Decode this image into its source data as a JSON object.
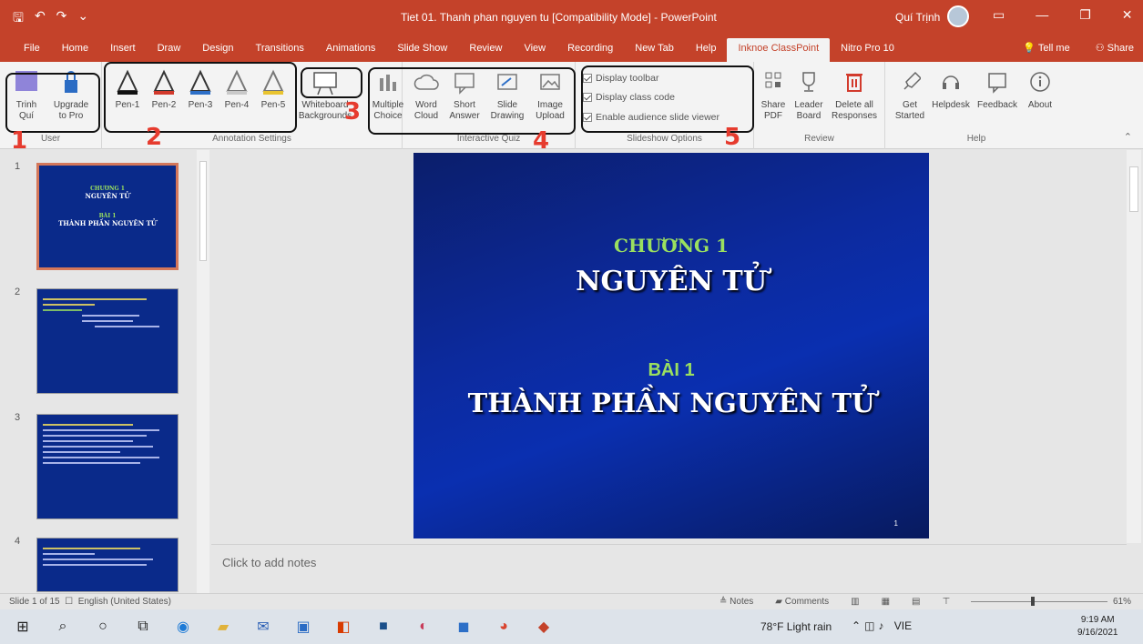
{
  "window": {
    "qat_icons": [
      "save-icon",
      "undo-icon",
      "redo-icon",
      "customize-icon"
    ],
    "doc_title": "Tiet 01. Thanh phan nguyen tu [Compatibility Mode] - PowerPoint",
    "user": "Quí Trịnh",
    "buttons": [
      "ribbon-display-icon",
      "minimize-icon",
      "restore-icon",
      "close-icon"
    ]
  },
  "tabs": [
    {
      "label": "File"
    },
    {
      "label": "Home"
    },
    {
      "label": "Insert"
    },
    {
      "label": "Draw"
    },
    {
      "label": "Design"
    },
    {
      "label": "Transitions"
    },
    {
      "label": "Animations"
    },
    {
      "label": "Slide Show"
    },
    {
      "label": "Review"
    },
    {
      "label": "View"
    },
    {
      "label": "Recording"
    },
    {
      "label": "New Tab"
    },
    {
      "label": "Help"
    },
    {
      "label": "Inknoe ClassPoint",
      "active": true
    },
    {
      "label": "Nitro Pro 10"
    }
  ],
  "tabs_right": {
    "tell": "Tell me",
    "share": "Share"
  },
  "ribbon": {
    "user": {
      "trinh": "Trinh",
      "quiz": "Quí",
      "upgrade1": "Upgrade",
      "upgrade2": "to Pro",
      "label": "User"
    },
    "pens": [
      {
        "label": "Pen-1",
        "color": "#111111"
      },
      {
        "label": "Pen-2",
        "color": "#d23a2c"
      },
      {
        "label": "Pen-3",
        "color": "#2d6fc7"
      },
      {
        "label": "Pen-4",
        "color": "#c9c9c9"
      },
      {
        "label": "Pen-5",
        "color": "#e9c430"
      }
    ],
    "annotation_label": "Annotation Settings",
    "whiteboard1": "Whiteboard",
    "whiteboard2": "Backgrounds",
    "quiz": [
      {
        "l1": "Multiple",
        "l2": "Choice"
      },
      {
        "l1": "Word",
        "l2": "Cloud"
      },
      {
        "l1": "Short",
        "l2": "Answer"
      },
      {
        "l1": "Slide",
        "l2": "Drawing"
      },
      {
        "l1": "Image",
        "l2": "Upload"
      }
    ],
    "quiz_label": "Interactive Quiz",
    "slideshow": [
      "Display toolbar",
      "Display class code",
      "Enable audience slide viewer"
    ],
    "slideshow_label": "Slideshow Options",
    "review": [
      {
        "l1": "Share",
        "l2": "PDF"
      },
      {
        "l1": "Leader",
        "l2": "Board"
      },
      {
        "l1": "Delete all",
        "l2": "Responses"
      }
    ],
    "review_label": "Review",
    "help": [
      {
        "l1": "Get",
        "l2": "Started"
      },
      {
        "l1": "Helpdesk",
        "l2": ""
      },
      {
        "l1": "Feedback",
        "l2": ""
      },
      {
        "l1": "About",
        "l2": ""
      }
    ],
    "help_label": "Help"
  },
  "annotations": [
    "1",
    "2",
    "3",
    "4",
    "5"
  ],
  "thumbnails": [
    {
      "num": "1",
      "title1": "CHƯƠNG 1",
      "title2": "NGUYÊN TỬ",
      "title3": "BÀI 1",
      "title4": "THÀNH PHẦN NGUYÊN TỬ"
    },
    {
      "num": "2"
    },
    {
      "num": "3"
    },
    {
      "num": "4"
    }
  ],
  "slide": {
    "line1": "CHƯƠNG 1",
    "line2": "NGUYÊN TỬ",
    "line3": "BÀI 1",
    "line4": "THÀNH PHẦN NGUYÊN TỬ",
    "page": "1"
  },
  "notes_placeholder": "Click to add notes",
  "status": {
    "slide": "Slide 1 of 15",
    "lang": "English (United States)",
    "notes": "Notes",
    "comments": "Comments",
    "zoom": "61%",
    "zoom_fraction": 0.45
  },
  "taskbar": {
    "weather": "78°F Light rain",
    "lang": "VIE",
    "time": "9:19 AM",
    "date": "9/16/2021"
  }
}
